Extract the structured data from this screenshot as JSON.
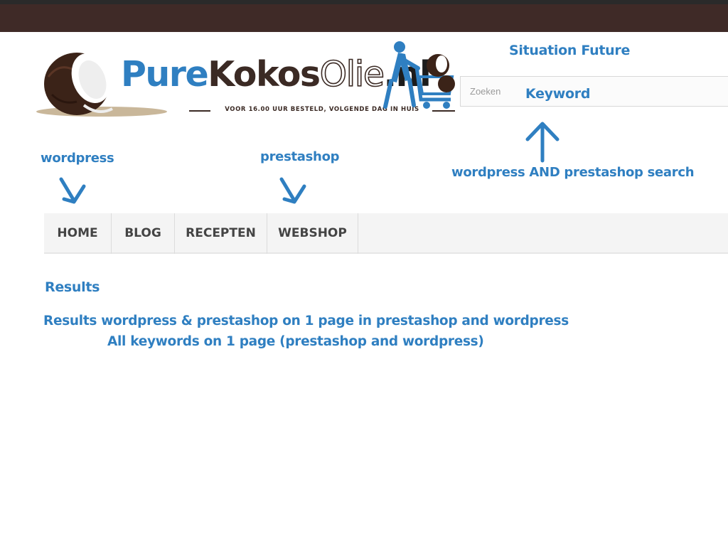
{
  "header": {
    "logo": {
      "part1": "Pure",
      "part2": "Kokos",
      "part3": "Olie",
      "part4": ".nl",
      "tagline": "VOOR 16.00 UUR BESTELD, VOLGENDE DAG IN HUIS"
    }
  },
  "search": {
    "placeholder": "Zoeken"
  },
  "nav": {
    "items": [
      {
        "label": "HOME"
      },
      {
        "label": "BLOG"
      },
      {
        "label": "RECEPTEN"
      },
      {
        "label": "WEBSHOP"
      }
    ]
  },
  "annotations": {
    "situation": "Situation Future",
    "keyword": "Keyword",
    "wordpress": "wordpress",
    "prestashop": "prestashop",
    "search_note": "wordpress AND prestashop search",
    "results_title": "Results",
    "results_line1": "Results wordpress & prestashop on 1 page in prestashop and wordpress",
    "results_line2": "All keywords on 1 page (prestashop and wordpress)"
  },
  "colors": {
    "annotation": "#2f7fc1",
    "topbar": "#3f2a27",
    "logo_blue": "#2f7fc1",
    "logo_brown": "#3b2a24"
  }
}
